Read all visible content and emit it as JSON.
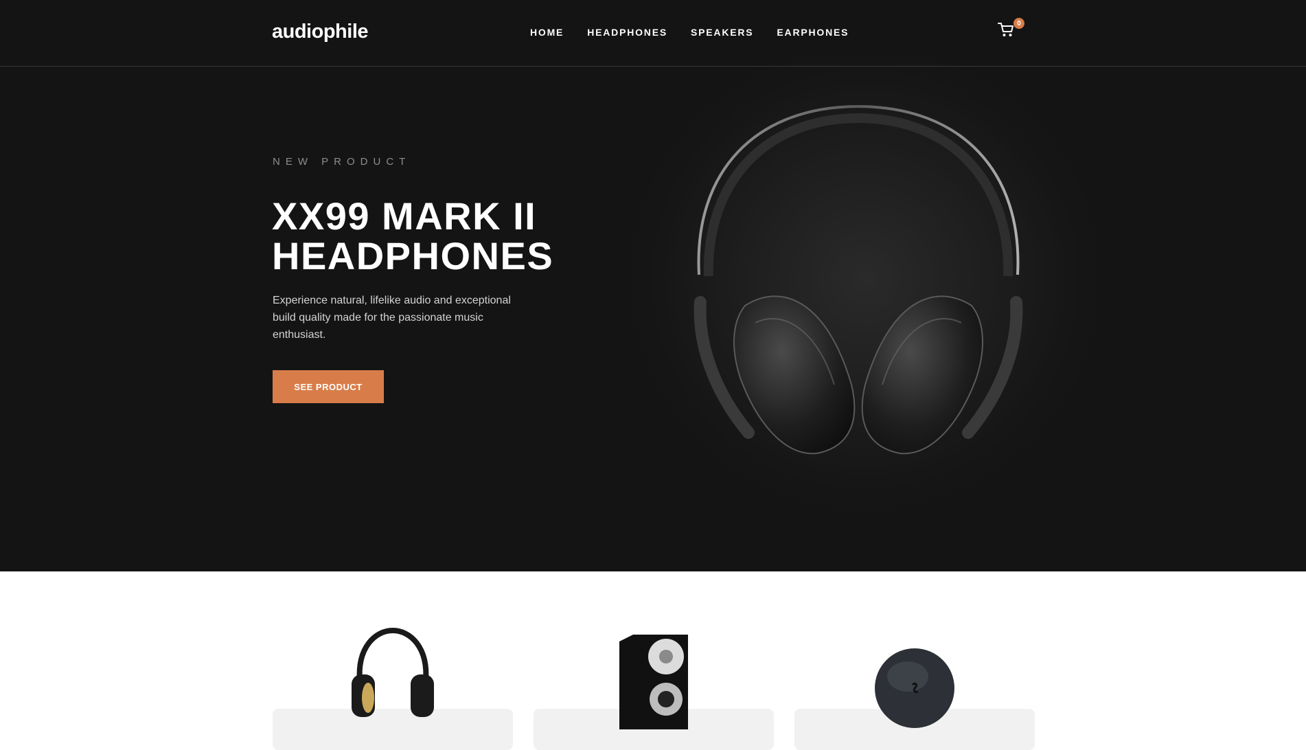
{
  "header": {
    "logo": "audiophile",
    "nav": [
      "HOME",
      "HEADPHONES",
      "SPEAKERS",
      "EARPHONES"
    ],
    "cart_count": "0"
  },
  "hero": {
    "overline": "NEW PRODUCT",
    "title": "XX99 MARK II HEADPHONES",
    "description": "Experience natural, lifelike audio and exceptional build quality made for the passionate music enthusiast.",
    "cta_label": "SEE PRODUCT"
  },
  "colors": {
    "accent": "#d87d4a",
    "hero_bg": "#141414",
    "card_bg": "#f1f1f1"
  },
  "icons": [
    "cart-icon"
  ]
}
